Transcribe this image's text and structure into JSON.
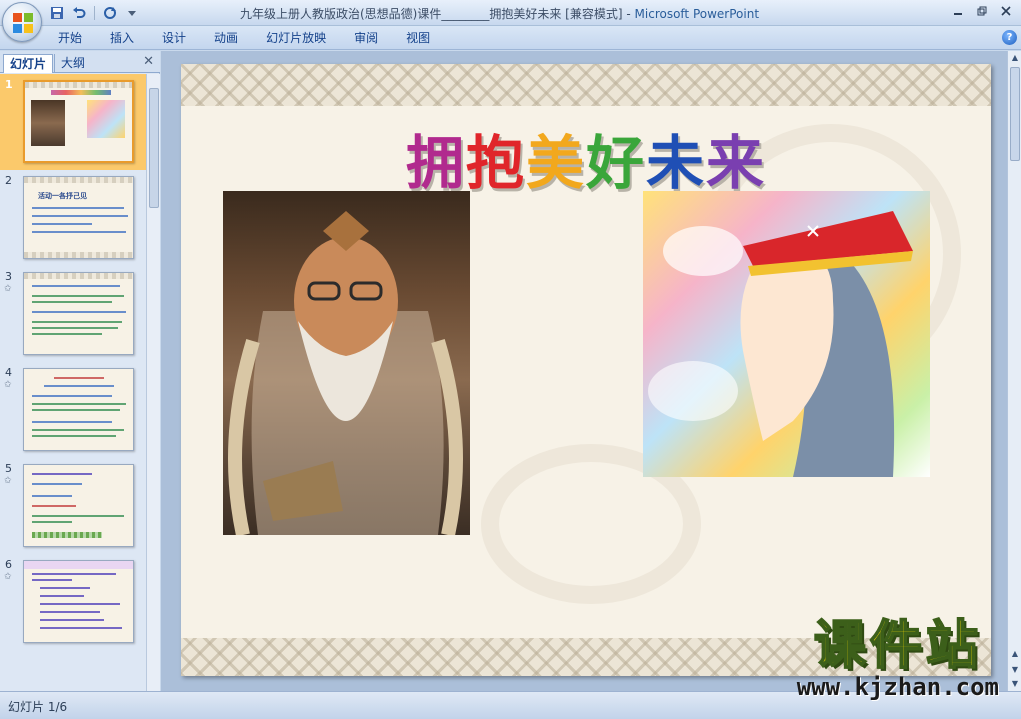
{
  "window": {
    "title": "九年级上册人教版政治(思想品德)课件________拥抱美好未来 [兼容模式]",
    "app_name": "Microsoft PowerPoint"
  },
  "ribbon": {
    "tabs": [
      "开始",
      "插入",
      "设计",
      "动画",
      "幻灯片放映",
      "审阅",
      "视图"
    ]
  },
  "left_panel": {
    "tab_slides": "幻灯片",
    "tab_outline": "大纲",
    "close": "✕",
    "thumbnails": [
      {
        "number": "1",
        "title": ""
      },
      {
        "number": "2",
        "title": "活动一各抒己见"
      },
      {
        "number": "3",
        "title": ""
      },
      {
        "number": "4",
        "title": ""
      },
      {
        "number": "5",
        "title": ""
      },
      {
        "number": "6",
        "title": ""
      }
    ]
  },
  "slide": {
    "title_chars": [
      "拥",
      "抱",
      "美",
      "好",
      "未",
      "来"
    ],
    "title_colors": [
      "#b12a8e",
      "#e0252a",
      "#f2a81d",
      "#3aa63a",
      "#1f4fb5",
      "#7a3fb0"
    ]
  },
  "status": {
    "slide_indicator": "幻灯片 1/6"
  },
  "watermark": {
    "big": "课件站",
    "url": "www.kjzhan.com"
  }
}
